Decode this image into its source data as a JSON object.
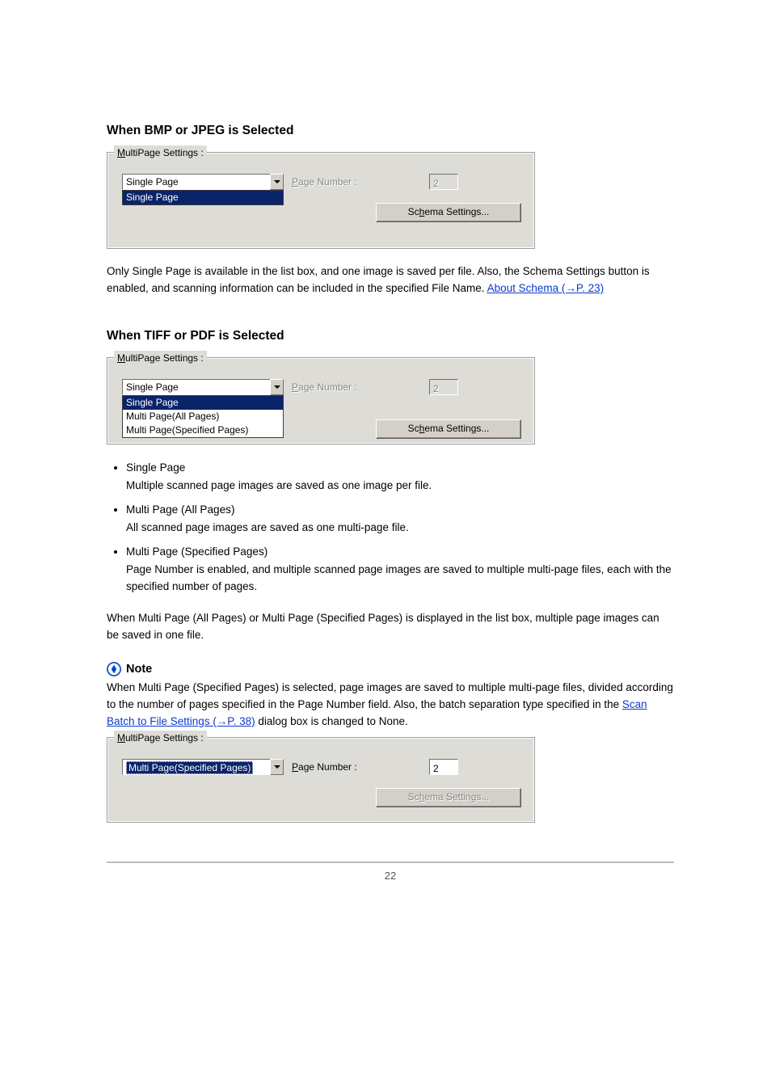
{
  "headings": {
    "bmp_jpeg": "When BMP or JPEG is Selected",
    "tiff_pdf": "When TIFF or PDF is Selected"
  },
  "groupbox": {
    "legend_prefix": "M",
    "legend_rest": "ultiPage Settings :"
  },
  "labels": {
    "page_number_prefix": "P",
    "page_number_rest": "age Number :",
    "schema_before": "Sc",
    "schema_ul": "h",
    "schema_after": "ema Settings..."
  },
  "combo": {
    "single_page": "Single Page",
    "multi_all": "Multi Page(All Pages)",
    "multi_spec": "Multi Page(Specified Pages)"
  },
  "fields": {
    "page_number_disabled_value": "2",
    "page_number_enabled_value": "2"
  },
  "paragraphs": {
    "bmp_jpeg_desc_1": "Only Single Page is available in the list box, and one image is saved per file. Also, the Schema Settings button is enabled, and scanning information can be included in the specified File Name. ",
    "about_schema_text": "About Schema (→P. 23)",
    "tiff_pdf_note": "When Multi Page (All Pages) or Multi Page (Specified Pages) is displayed in the list box, multiple page images can be saved in one file.",
    "note_para_1": "When Multi Page (Specified Pages) is selected, page images are saved to multiple multi-page files, divided according to the number of pages specified in the Page Number field. Also, the batch separation type specified in the ",
    "note_para_link": "Scan Batch to File Settings  (→P. 38)",
    "note_para_2": " dialog box is changed to None."
  },
  "list": {
    "single_page_title": "Single Page",
    "single_page_desc": "Multiple scanned page images are saved as one image per file.",
    "multi_all_title": "Multi Page (All Pages)",
    "multi_all_desc": "All scanned page images are saved as one multi-page file.",
    "multi_spec_title": "Multi Page (Specified Pages)",
    "multi_spec_desc": "Page Number is enabled, and multiple scanned page images are saved to multiple multi-page files, each with the specified number of pages."
  },
  "note": {
    "label": "Note"
  },
  "page_number_footer": "22"
}
